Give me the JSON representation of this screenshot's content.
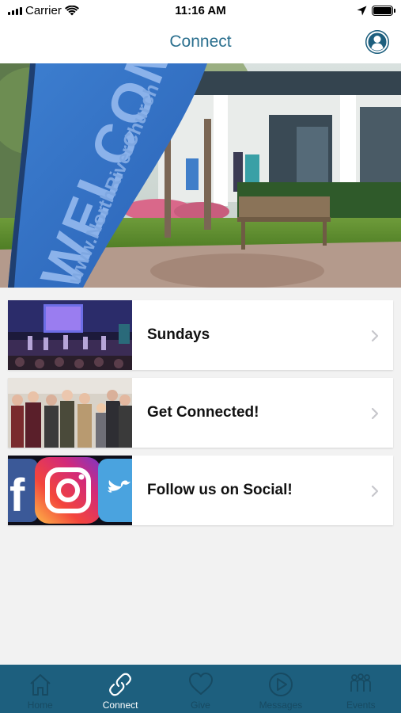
{
  "status_bar": {
    "carrier": "Carrier",
    "time": "11:16 AM"
  },
  "nav": {
    "title": "Connect"
  },
  "hero": {
    "banner_text": "WELCOME",
    "banner_url": "www.NorthRiverChurch"
  },
  "cards": [
    {
      "label": "Sundays"
    },
    {
      "label": "Get Connected!"
    },
    {
      "label": "Follow us on Social!"
    }
  ],
  "tabs": [
    {
      "label": "Home",
      "icon": "home-icon"
    },
    {
      "label": "Connect",
      "icon": "link-icon"
    },
    {
      "label": "Give",
      "icon": "heart-icon"
    },
    {
      "label": "Messages",
      "icon": "play-circle-icon"
    },
    {
      "label": "Events",
      "icon": "people-icon"
    }
  ],
  "colors": {
    "accent": "#1d5f7e",
    "title": "#2a6f8e",
    "tab_active": "#ffffff",
    "tab_inactive": "#174a62"
  }
}
